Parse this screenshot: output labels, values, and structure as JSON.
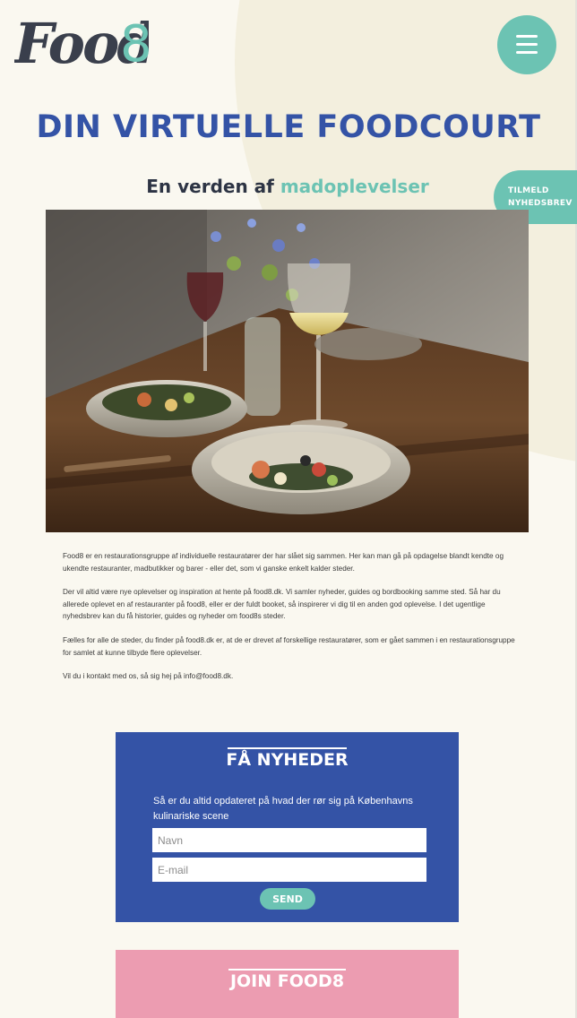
{
  "header": {
    "logo_text": "Food",
    "logo_number": "8",
    "menu_icon": "hamburger-icon"
  },
  "hero": {
    "title": "DIN VIRTUELLE FOODCOURT",
    "subtitle_prefix": "En verden af ",
    "subtitle_highlight": "madoplevelser",
    "newsletter_tab_line1": "TILMELD",
    "newsletter_tab_line2": "NYHEDSBREV"
  },
  "intro": {
    "paragraphs": [
      "Food8 er en restaurationsgruppe af individuelle restauratører der har slået sig sammen. Her kan man gå på opdagelse blandt kendte og ukendte restauranter, madbutikker og barer - eller det, som vi ganske enkelt kalder steder.",
      "Der vil altid være nye oplevelser og inspiration at hente på food8.dk. Vi samler nyheder, guides og bordbooking samme sted. Så har du allerede oplevet en af restauranter på food8, eller er der fuldt booket, så inspirerer vi dig til en anden god oplevelse. I det ugentlige nyhedsbrev kan du få historier, guides og nyheder om food8s steder.",
      "Fælles for alle de steder, du finder på food8.dk er, at de er drevet af forskellige restauratører, som er gået sammen i en restaurationsgruppe for samlet at kunne tilbyde flere oplevelser.",
      "Vil du i kontakt med os, så sig hej på info@food8.dk."
    ]
  },
  "signup": {
    "title": "FÅ NYHEDER",
    "text": "Så er du altid opdateret på hvad der rør sig på Københavns kulinariske scene",
    "name_placeholder": "Navn",
    "email_placeholder": "E-mail",
    "send_label": "SEND"
  },
  "join": {
    "title": "JOIN FOOD8"
  },
  "colors": {
    "background": "#faf8f0",
    "primary_blue": "#3453a6",
    "accent_teal": "#6cc3b3",
    "pink": "#ec9cb1",
    "logo_dark": "#3a3f4c"
  }
}
